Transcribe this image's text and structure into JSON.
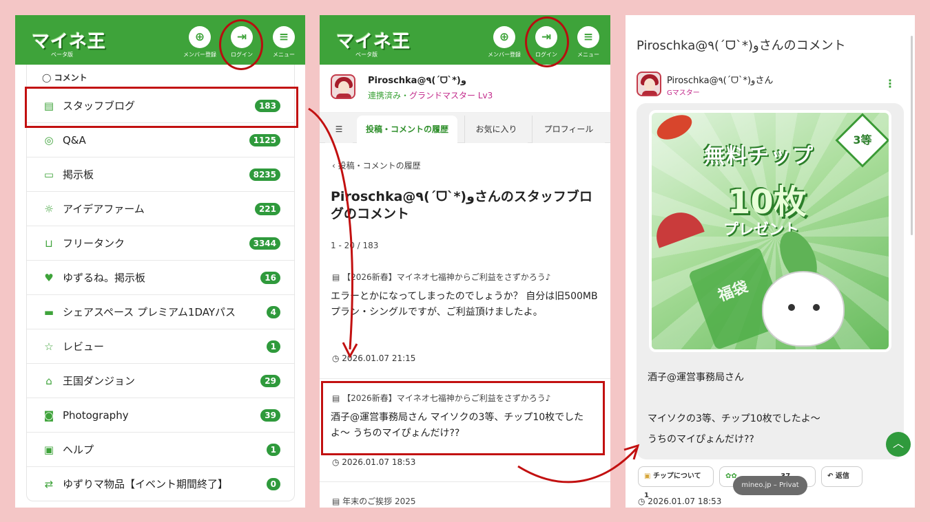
{
  "header": {
    "logo": "マイネ王",
    "logo_sub": "ベータ版",
    "signup_label": "メンバー登録",
    "login_label": "ログイン",
    "menu_label": "メニュー"
  },
  "panel1": {
    "section_label": "コメント",
    "categories": [
      {
        "label": "スタッフブログ",
        "count": "183",
        "icon": "blog-icon"
      },
      {
        "label": "Q&A",
        "count": "1125",
        "icon": "qa-icon"
      },
      {
        "label": "掲示板",
        "count": "8235",
        "icon": "board-icon"
      },
      {
        "label": "アイデアファーム",
        "count": "221",
        "icon": "idea-icon"
      },
      {
        "label": "フリータンク",
        "count": "3344",
        "icon": "tank-icon"
      },
      {
        "label": "ゆずるね。掲示板",
        "count": "16",
        "icon": "hand-icon"
      },
      {
        "label": "シェアスペース プレミアム1DAYパス",
        "count": "4",
        "icon": "ticket-icon"
      },
      {
        "label": "レビュー",
        "count": "1",
        "icon": "star-icon"
      },
      {
        "label": "王国ダンジョン",
        "count": "29",
        "icon": "dungeon-icon"
      },
      {
        "label": "Photography",
        "count": "39",
        "icon": "camera-icon"
      },
      {
        "label": "ヘルプ",
        "count": "1",
        "icon": "help-icon"
      },
      {
        "label": "ゆずりマ物品【イベント期間終了】",
        "count": "0",
        "icon": "swap-icon"
      }
    ]
  },
  "panel2": {
    "user_name": "Piroschka@٩(ˊᗜˋ*)و",
    "user_status": "連携済み・",
    "user_rank": "グランドマスター Lv3",
    "tabs": [
      "投稿・コメントの履歴",
      "お気に入り",
      "プロフィール"
    ],
    "breadcrumb": "投稿・コメントの履歴",
    "page_title": "Piroschka@٩(ˊᗜˋ*)وさんのスタッフブログのコメント",
    "range": "1 - 20 / 183",
    "posts": [
      {
        "source": "【2026新春】マイネオ七福神からご利益をさずかろう♪",
        "body": "エラーとかになってしまったのでしょうか？ 自分は旧500MBプラン・シングルですが、ご利益頂けましたよ。",
        "time": "2026.01.07 21:15"
      },
      {
        "source": "【2026新春】マイネオ七福神からご利益をさずかろう♪",
        "body": "酒子@運営事務局さん マイソクの3等、チップ10枚でしたよ〜 うちのマイぴょんだけ??",
        "time": "2026.01.07 18:53"
      },
      {
        "source": "年末のご挨拶 2025"
      }
    ]
  },
  "panel3": {
    "title": "Piroschka@٩(ˊᗜˋ*)وさんのコメント",
    "user_name": "Piroschka@٩(ˊᗜˋ*)وさん",
    "user_rank": "Gマスター",
    "promo": {
      "line1": "無料チップ",
      "line2": "10枚",
      "line3": "プレゼント",
      "tag": "3等",
      "bag": "福袋"
    },
    "comment_lines": [
      "酒子@運営事務局さん",
      "マイソクの3等、チップ10枚でしたよ〜",
      "うちのマイぴょんだけ??"
    ],
    "chip_label": "チップについて",
    "chip_count": "1",
    "like_count": "37",
    "reply_label": "返信",
    "time": "2026.01.07 18:53",
    "toast": "mineo.jp – Privat"
  },
  "colors": {
    "brand_green": "#3ea33a",
    "badge_green": "#2f9a3c",
    "annotation_red": "#c21010",
    "rank_pink": "#c2298a"
  }
}
